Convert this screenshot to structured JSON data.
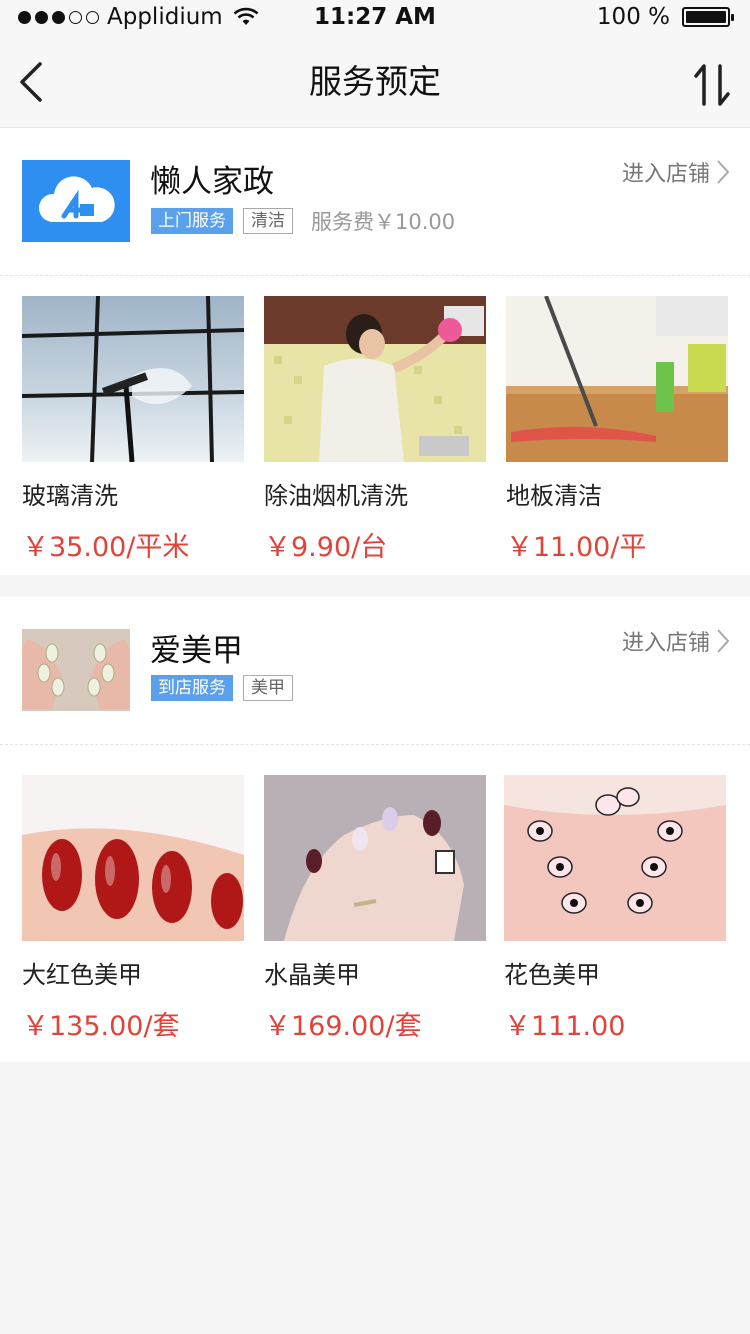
{
  "status_bar": {
    "carrier": "Applidium",
    "time": "11:27 AM",
    "battery": "100 %"
  },
  "nav": {
    "title": "服务预定",
    "back_icon": "chevron-left-icon",
    "sort_icon": "sort-updown-icon"
  },
  "stores": [
    {
      "name": "懒人家政",
      "tags": {
        "primary": "上门服务",
        "secondary": "清洁"
      },
      "fee": "服务费￥10.00",
      "enter_label": "进入店铺",
      "products": [
        {
          "name": "玻璃清洗",
          "price": "￥35.00/平米"
        },
        {
          "name": "除油烟机清洗",
          "price": "￥9.90/台"
        },
        {
          "name": "地板清洁",
          "price": "￥11.00/平"
        }
      ]
    },
    {
      "name": "爱美甲",
      "tags": {
        "primary": "到店服务",
        "secondary": "美甲"
      },
      "fee": "",
      "enter_label": "进入店铺",
      "products": [
        {
          "name": "大红色美甲",
          "price": "￥135.00/套"
        },
        {
          "name": "水晶美甲",
          "price": "￥169.00/套"
        },
        {
          "name": "花色美甲",
          "price": "￥111.00"
        }
      ]
    }
  ],
  "colors": {
    "accent_blue": "#5aa0ea",
    "price_red": "#e0433a",
    "logo_blue": "#2f8ff0"
  }
}
